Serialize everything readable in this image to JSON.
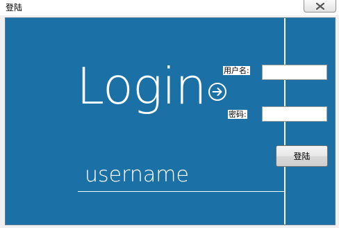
{
  "window": {
    "title": "登陆",
    "close_icon": "close-icon"
  },
  "form": {
    "heading": "Login",
    "arrow_icon": "arrow-right-circle-icon",
    "username_label": "用户名:",
    "username_value": "",
    "password_label": "密码:",
    "password_value": "",
    "submit_label": "登陆",
    "username_hint": "username"
  },
  "colors": {
    "panel_background": "#1b70a6",
    "foreground": "#ffffff"
  }
}
